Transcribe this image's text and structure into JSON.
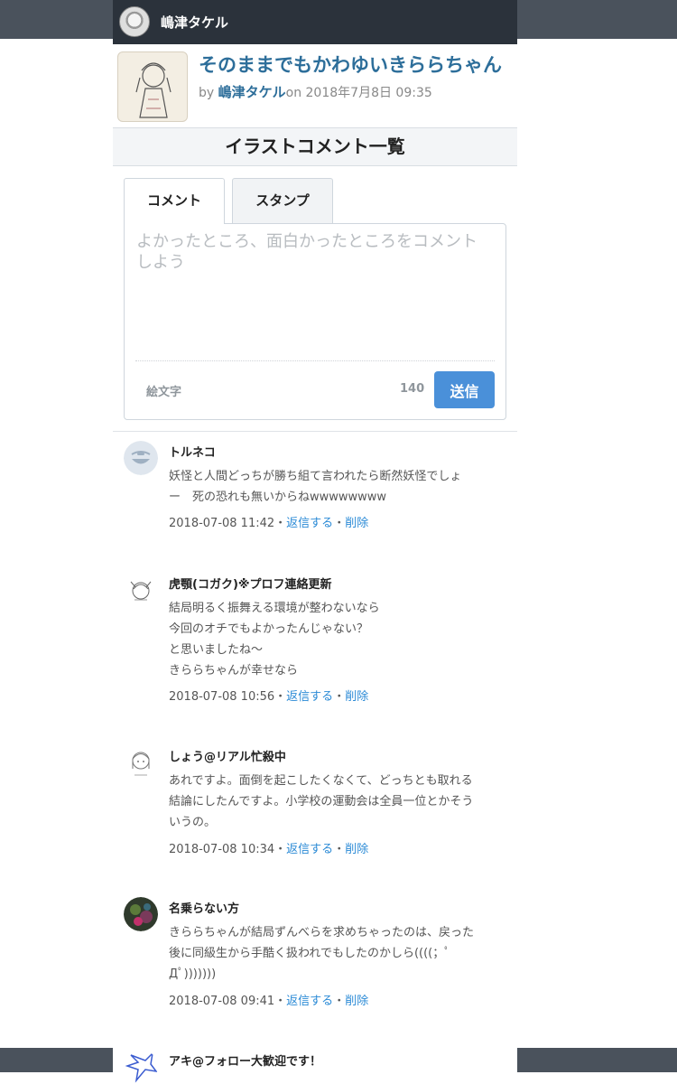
{
  "header": {
    "user_name": "嶋津タケル"
  },
  "post": {
    "title": "そのままでもかわゆいきららちゃん",
    "by": "by",
    "author": "嶋津タケル",
    "on_date": "on 2018年7月8日 09:35"
  },
  "section_title": "イラストコメント一覧",
  "tabs": {
    "comment": "コメント",
    "stamp": "スタンプ"
  },
  "form": {
    "placeholder": "よかったところ、面白かったところをコメントしよう",
    "emoji_label": "絵文字",
    "char_count": "140",
    "send_label": "送信"
  },
  "comments": [
    {
      "name": "トルネコ",
      "lines": [
        "妖怪と人間どっちが勝ち組て言われたら断然妖怪でしょ",
        "ー　死の恐れも無いからねwwwwwwww"
      ],
      "date": "2018-07-08 11:42",
      "reply": "返信する",
      "delete": "削除"
    },
    {
      "name": "虎顎(コガク)※プロフ連絡更新",
      "lines": [
        "結局明るく振舞える環境が整わないなら",
        "今回のオチでもよかったんじゃない？",
        "と思いましたね〜",
        "きららちゃんが幸せなら"
      ],
      "date": "2018-07-08 10:56",
      "reply": "返信する",
      "delete": "削除"
    },
    {
      "name": "しょう@リアル忙殺中",
      "lines": [
        "あれですよ。面倒を起こしたくなくて、どっちとも取れる",
        "結論にしたんですよ。小学校の運動会は全員一位とかそう",
        "いうの。"
      ],
      "date": "2018-07-08 10:34",
      "reply": "返信する",
      "delete": "削除"
    },
    {
      "name": "名乗らない方",
      "lines": [
        "きららちゃんが結局ずんべらを求めちゃったのは、戻った",
        "後に同級生から手酷く扱われでもしたのかしら((((；ﾟ",
        "Дﾟ)))))))"
      ],
      "date": "2018-07-08 09:41",
      "reply": "返信する",
      "delete": "削除"
    },
    {
      "name": "アキ@フォロー大歓迎です！"
    }
  ],
  "meta_separator": "・"
}
